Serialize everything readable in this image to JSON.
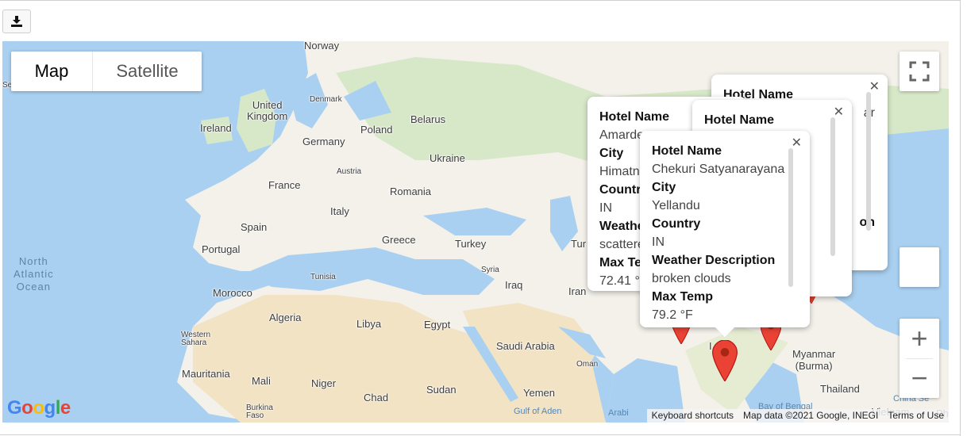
{
  "download_icon": "download-icon",
  "map_type": {
    "map_label": "Map",
    "satellite_label": "Satellite",
    "selected": "Map"
  },
  "controls": {
    "fullscreen_icon": "fullscreen-icon",
    "zoom_in": "+",
    "zoom_out": "−"
  },
  "labels": {
    "norway": "Norway",
    "denmark": "Denmark",
    "united_kingdom": "United\nKingdom",
    "ireland": "Ireland",
    "poland": "Poland",
    "belarus": "Belarus",
    "germany": "Germany",
    "ukraine": "Ukraine",
    "austria": "Austria",
    "france": "France",
    "romania": "Romania",
    "italy": "Italy",
    "spain": "Spain",
    "portugal": "Portugal",
    "greece": "Greece",
    "turkey": "Turkey",
    "tunisia": "Tunisia",
    "syria": "Syria",
    "iraq": "Iraq",
    "iran": "Iran",
    "morocco": "Morocco",
    "algeria": "Algeria",
    "libya": "Libya",
    "egypt": "Egypt",
    "western_sahara": "Western\nSahara",
    "saudi_arabia": "Saudi Arabia",
    "oman": "Oman",
    "mauritania": "Mauritania",
    "mali": "Mali",
    "niger": "Niger",
    "chad": "Chad",
    "sudan": "Sudan",
    "yemen": "Yemen",
    "burkina_faso": "Burkina\nFaso",
    "gulf_of_aden": "Gulf of Aden",
    "arabi": "Arabi",
    "myanmar": "Myanmar\n(Burma)",
    "thailand": "Thailand",
    "bay_of_bengal": "Bay of Bengal",
    "china_sea": "China Se",
    "north_atlantic": "North\nAtlantic\nOcean",
    "tur": "Tur",
    "se": "Se",
    "vietnam": "Vietnam",
    "ph": "Ph",
    "l": "I"
  },
  "info_windows": [
    {
      "id": "back",
      "visible_pairs": [
        [
          "Hotel Name",
          ""
        ],
        [
          "",
          "ar"
        ],
        [
          "",
          ""
        ],
        [
          "",
          ""
        ],
        [
          "",
          "on"
        ]
      ]
    },
    {
      "id": "left",
      "fields": [
        {
          "key": "Hotel Name",
          "value": "Amarde"
        },
        {
          "key": "City",
          "value": "Himatn"
        },
        {
          "key": "Country",
          "value": "IN"
        },
        {
          "key": "Weathe",
          "value": "scattere"
        },
        {
          "key": "Max Te",
          "value": "72.41 °"
        }
      ]
    },
    {
      "id": "middle",
      "fields": [
        {
          "key": "Hotel Name",
          "value": ""
        }
      ]
    },
    {
      "id": "front",
      "fields": [
        {
          "key": "Hotel Name",
          "value": "Chekuri Satyanarayana"
        },
        {
          "key": "City",
          "value": "Yellandu"
        },
        {
          "key": "Country",
          "value": "IN"
        },
        {
          "key": "Weather Description",
          "value": "broken clouds"
        },
        {
          "key": "Max Temp",
          "value": "79.2 °F"
        }
      ]
    }
  ],
  "attribution": {
    "keyboard": "Keyboard shortcuts",
    "map_data": "Map data ©2021 Google, INEGI",
    "terms": "Terms of Use"
  },
  "logo": "Google",
  "colors": {
    "water": "#a9d0f0",
    "land": "#f3f1ea",
    "desert": "#f2e3c4",
    "green": "#cfe6c0",
    "pin": "#ea4335"
  }
}
